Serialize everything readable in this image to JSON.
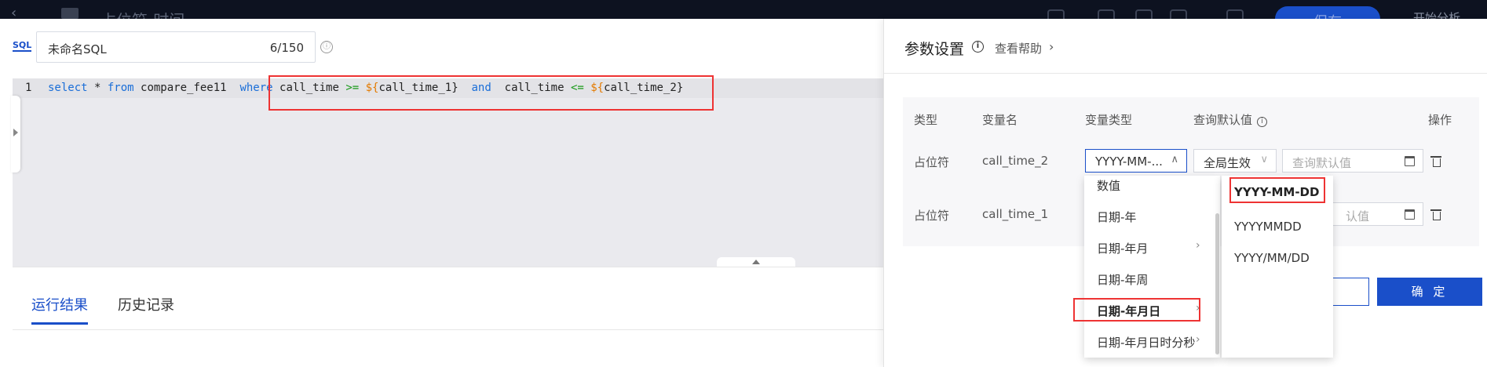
{
  "topbar": {
    "title": "占位符-时间",
    "save_label": "保存",
    "analyze_label": "开始分析"
  },
  "editor": {
    "sql_icon": "SQL",
    "query_name": "未命名SQL",
    "char_count": "6/150",
    "line_number": "1",
    "code_tokens": {
      "t1": "select",
      "t2": " * ",
      "t3": "from",
      "t4": " compare_fee11  ",
      "t5": "where",
      "t6": " call_time ",
      "t7": ">=",
      "t8": " ",
      "t9": "${",
      "t10": "call_time_1}  ",
      "t11": "and",
      "t12": "  call_time ",
      "t13": "<=",
      "t14": " ",
      "t15": "${",
      "t16": "call_time_2}"
    }
  },
  "result_tabs": {
    "run_result": "运行结果",
    "history": "历史记录"
  },
  "panel": {
    "title": "参数设置",
    "help": "查看帮助",
    "headers": {
      "type": "类型",
      "var_name": "变量名",
      "var_type": "变量类型",
      "default": "查询默认值",
      "action": "操作"
    },
    "rows": [
      {
        "type": "占位符",
        "name": "call_time_2",
        "var_type": "YYYY-MM-...",
        "scope": "全局生效",
        "default_placeholder": "查询默认值"
      },
      {
        "type": "占位符",
        "name": "call_time_1",
        "default_placeholder": "认值"
      }
    ],
    "confirm": "确 定"
  },
  "dropdown": {
    "items": [
      "数值",
      "日期-年",
      "日期-年月",
      "日期-年周",
      "日期-年月日",
      "日期-年月日时分秒"
    ],
    "sub_items": [
      "YYYY-MM-DD",
      "YYYYMMDD",
      "YYYY/MM/DD"
    ]
  },
  "icons": {
    "info": "ⓘ",
    "chev_right": "›",
    "chev_up": "∧",
    "chev_down": "∨"
  },
  "colors": {
    "accent": "#1a4fc9",
    "highlight_border": "#e33333",
    "keyword": "#1a6ed8",
    "operator": "#1a9a1a",
    "template_var": "#e37a00"
  }
}
